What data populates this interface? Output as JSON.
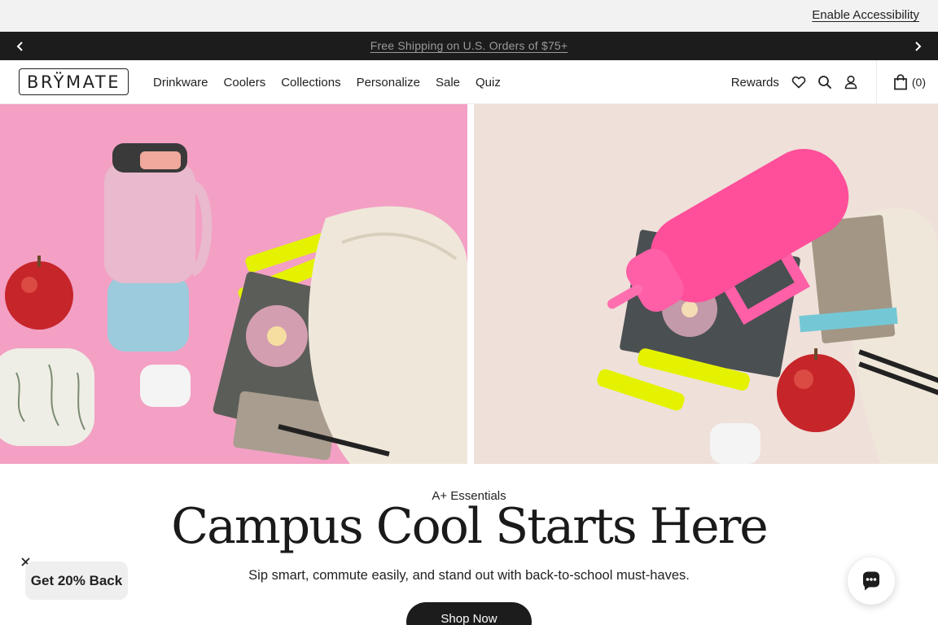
{
  "accessibility": {
    "link_label": "Enable Accessibility"
  },
  "announcement": {
    "message": "Free Shipping on U.S. Orders of $75+"
  },
  "header": {
    "logo_text": "BRŸMATE",
    "nav": [
      "Drinkware",
      "Coolers",
      "Collections",
      "Personalize",
      "Sale",
      "Quiz"
    ],
    "rewards_label": "Rewards",
    "cart_count": "(0)"
  },
  "hero": {
    "eyebrow": "A+ Essentials",
    "headline": "Campus Cool Starts Here",
    "subhead": "Sip smart, commute easily, and stand out with back-to-school must-haves.",
    "cta_label": "Shop Now"
  },
  "promo": {
    "label": "Get 20% Back"
  },
  "colors": {
    "announcement_bg": "#1c1c1c",
    "hero_left_bg": "#f3a0c4",
    "hero_right_bg": "#efe0da",
    "tumbler_pink": "#ff4f9a",
    "button_dark": "#1c1c1c"
  },
  "icons": [
    "chevron-left-icon",
    "chevron-right-icon",
    "heart-icon",
    "search-icon",
    "account-icon",
    "cart-icon",
    "close-icon",
    "chat-icon"
  ]
}
